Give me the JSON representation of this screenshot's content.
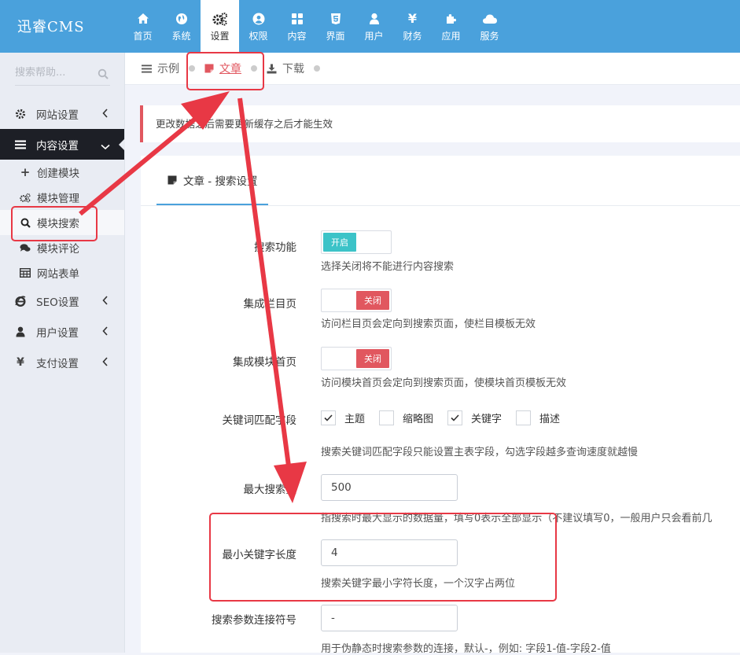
{
  "brand": "迅睿CMS",
  "topnav": [
    {
      "label": "首页",
      "icon": "home-icon"
    },
    {
      "label": "系统",
      "icon": "globe-icon"
    },
    {
      "label": "设置",
      "icon": "cogs-icon",
      "active": true
    },
    {
      "label": "权限",
      "icon": "user-circle-icon"
    },
    {
      "label": "内容",
      "icon": "grid-icon"
    },
    {
      "label": "界面",
      "icon": "html5-icon"
    },
    {
      "label": "用户",
      "icon": "user-icon"
    },
    {
      "label": "财务",
      "icon": "yen-icon"
    },
    {
      "label": "应用",
      "icon": "puzzle-icon"
    },
    {
      "label": "服务",
      "icon": "cloud-icon"
    }
  ],
  "sidebar": {
    "search_placeholder": "搜索帮助...",
    "menu": [
      {
        "label": "网站设置",
        "icon": "gear-icon"
      },
      {
        "label": "内容设置",
        "icon": "bars-icon",
        "open": true
      },
      {
        "label": "SEO设置",
        "icon": "ie-icon"
      },
      {
        "label": "用户设置",
        "icon": "user-icon"
      },
      {
        "label": "支付设置",
        "icon": "yen-icon"
      }
    ],
    "submenu": [
      {
        "label": "创建模块",
        "icon": "plus-icon"
      },
      {
        "label": "模块管理",
        "icon": "cogs-icon"
      },
      {
        "label": "模块搜索",
        "icon": "search-icon",
        "active": true
      },
      {
        "label": "模块评论",
        "icon": "comments-icon"
      },
      {
        "label": "网站表单",
        "icon": "table-icon"
      }
    ]
  },
  "breadcrumbs": [
    {
      "label": "示例",
      "icon": "bars-icon"
    },
    {
      "label": "文章",
      "icon": "sticky-note-icon",
      "current": true
    },
    {
      "label": "下载",
      "icon": "download-icon"
    }
  ],
  "alert": "更改数据之后需要更新缓存之后才能生效",
  "panel_tab": "文章 - 搜索设置",
  "form": {
    "search_func": {
      "label": "搜索功能",
      "state": "开启",
      "help": "选择关闭将不能进行内容搜索"
    },
    "cat_page": {
      "label": "集成栏目页",
      "state": "关闭",
      "help": "访问栏目页会定向到搜索页面，使栏目模板无效"
    },
    "module_home": {
      "label": "集成模块首页",
      "state": "关闭",
      "help": "访问模块首页会定向到搜索页面，使模块首页模板无效"
    },
    "match_fields": {
      "label": "关键词匹配字段",
      "options": [
        {
          "label": "主题",
          "checked": true
        },
        {
          "label": "缩略图",
          "checked": false
        },
        {
          "label": "关键字",
          "checked": true
        },
        {
          "label": "描述",
          "checked": false
        }
      ],
      "help": "搜索关键词匹配字段只能设置主表字段，勾选字段越多查询速度就越慢"
    },
    "max_results": {
      "label": "最大搜索量",
      "value": "500",
      "help": "指搜索时最大显示的数据量，填写0表示全部显示（不建议填写0，一般用户只会看前几"
    },
    "min_keyword": {
      "label": "最小关键字长度",
      "value": "4",
      "help": "搜索关键字最小字符长度，一个汉字占两位"
    },
    "separator": {
      "label": "搜索参数连接符号",
      "value": "-",
      "help": "用于伪静态时搜索参数的连接，默认-，例如: 字段1-值-字段2-值"
    }
  }
}
